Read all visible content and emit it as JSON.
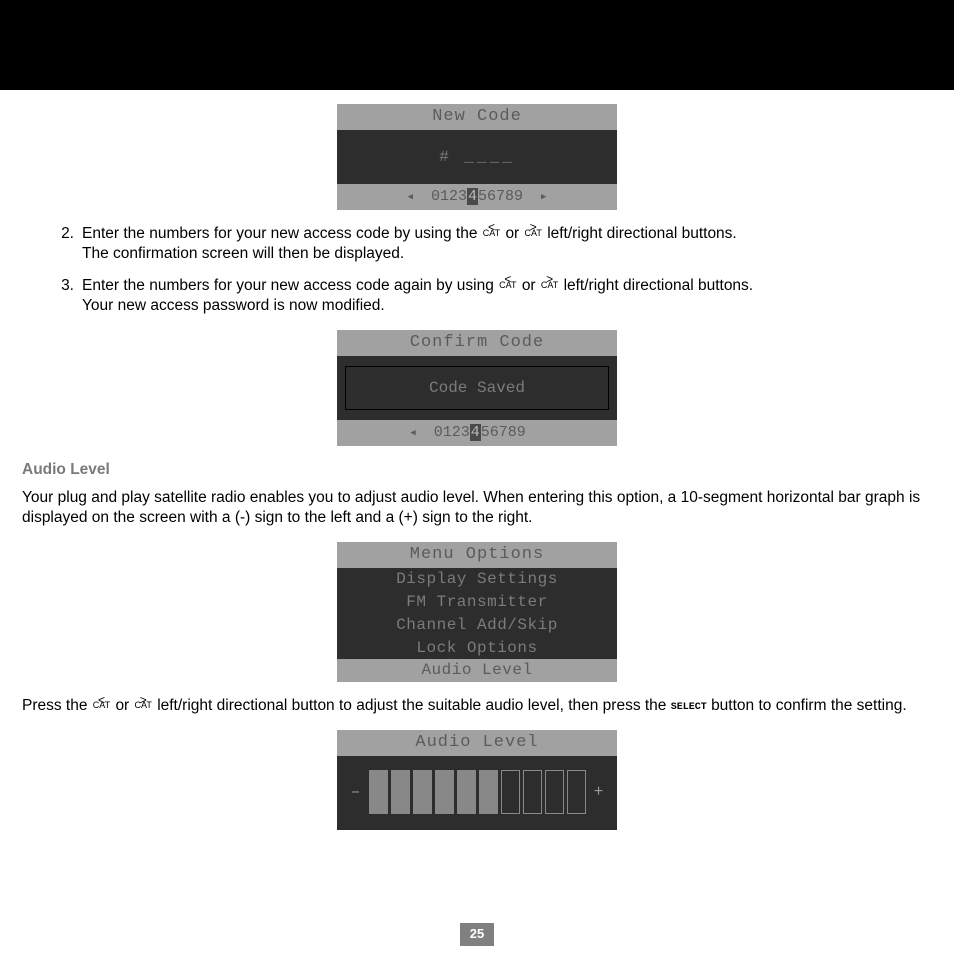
{
  "lcd1": {
    "title": "New Code",
    "prompt": "# ____",
    "digits_pre": "0123",
    "digit_hl": "4",
    "digits_post": "56789",
    "tri_left": "◀",
    "tri_right": "▶"
  },
  "step2": {
    "num": "2.",
    "text_a": "Enter the numbers for your new access code by using the ",
    "or": " or ",
    "text_b": " left/right directional buttons.",
    "text_c": "The confirmation screen will then be displayed."
  },
  "step3": {
    "num": "3.",
    "text_a": "Enter the numbers for your new access code again by using ",
    "or": " or ",
    "text_b": " left/right directional buttons.",
    "text_c": "Your new access password is now modified."
  },
  "cat": {
    "left_arrow": "<",
    "right_arrow": ">",
    "label": "CAT"
  },
  "lcd2": {
    "title": "Confirm Code",
    "saved": "Code Saved",
    "digits_pre": "0123",
    "digit_hl": "4",
    "digits_post": "56789",
    "tri_left": "◀"
  },
  "audio_heading": "Audio Level",
  "audio_para": "Your plug and play satellite radio enables you to adjust audio level. When entering this option, a 10-segment horizontal bar graph is displayed on the screen with a (-) sign to the left and a (+) sign to the right.",
  "lcd3": {
    "title": "Menu Options",
    "r1": "Display Settings",
    "r2": "FM Transmitter",
    "r3": "Channel Add/Skip",
    "r4": "Lock Options",
    "r5": "Audio Level"
  },
  "press_para": {
    "a": "Press  the ",
    "or": " or ",
    "b": " left/right directional button to adjust the suitable audio level, then press the ",
    "c": " button to confirm the setting."
  },
  "select_label": "SELECT",
  "lcd4": {
    "title": "Audio Level",
    "minus": "–",
    "plus": "+",
    "filled": 6,
    "total": 10
  },
  "page_number": "25"
}
